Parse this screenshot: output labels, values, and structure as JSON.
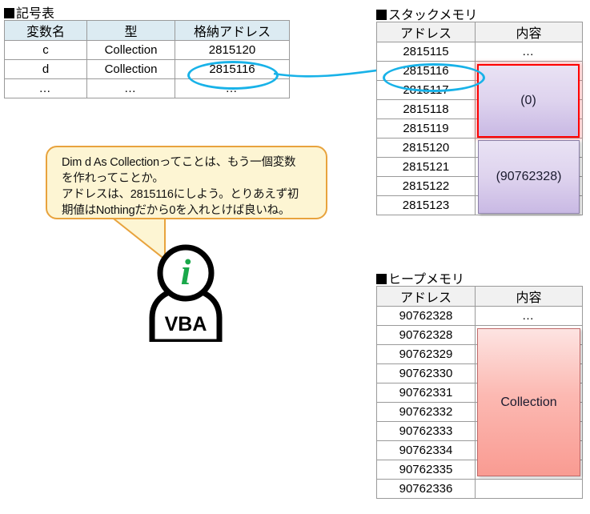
{
  "sections": {
    "symbol_table_title": "記号表",
    "stack_memory_title": "スタックメモリ",
    "heap_memory_title": "ヒープメモリ"
  },
  "symbol_table": {
    "headers": [
      "変数名",
      "型",
      "格納アドレス"
    ],
    "rows": [
      [
        "c",
        "Collection",
        "2815120"
      ],
      [
        "d",
        "Collection",
        "2815116"
      ],
      [
        "…",
        "…",
        "…"
      ]
    ],
    "highlighted_value": "2815116",
    "header_bg": "#dcebf2"
  },
  "stack_memory": {
    "headers": [
      "アドレス",
      "内容"
    ],
    "addresses": [
      "2815115",
      "2815116",
      "2815117",
      "2815118",
      "2815119",
      "2815120",
      "2815121",
      "2815122",
      "2815123"
    ],
    "top_content": "…",
    "highlighted_address": "2815116",
    "blocks": [
      {
        "label": "(0)",
        "border_color": "#ff0000",
        "fill": "#ded3ee",
        "spans": [
          "2815116",
          "2815117",
          "2815118",
          "2815119"
        ]
      },
      {
        "label": "(90762328)",
        "border_color": "#8a7fa8",
        "fill": "#ded3ee",
        "spans": [
          "2815120",
          "2815121",
          "2815122",
          "2815123"
        ]
      }
    ],
    "header_bg": "#f1f1f1"
  },
  "heap_memory": {
    "headers": [
      "アドレス",
      "内容"
    ],
    "addresses": [
      "90762328",
      "90762328",
      "90762329",
      "90762330",
      "90762331",
      "90762332",
      "90762333",
      "90762334",
      "90762335",
      "90762336"
    ],
    "top_content": "…",
    "blocks": [
      {
        "label": "Collection",
        "border_color": "#c06a6a",
        "fill": "#fcb9b2",
        "spans": [
          "90762328",
          "90762335"
        ]
      }
    ],
    "header_bg": "#f1f1f1"
  },
  "speech_bubble": {
    "text": "Dim d As Collectionってことは、もう一個変数\nを作れってことか。\nアドレスは、2815116にしよう。とりあえず初\n期値はNothingだから0を入れとけば良いね。",
    "bg_color": "#fdf5d3",
    "border_color": "#e8a33d"
  },
  "avatar": {
    "head_symbol": "i",
    "body_label": "VBA",
    "symbol_color": "#1aa84a",
    "outline_color": "#000000"
  },
  "connector": {
    "color": "#18b2e8",
    "from": "2815116",
    "to": "2815116"
  }
}
